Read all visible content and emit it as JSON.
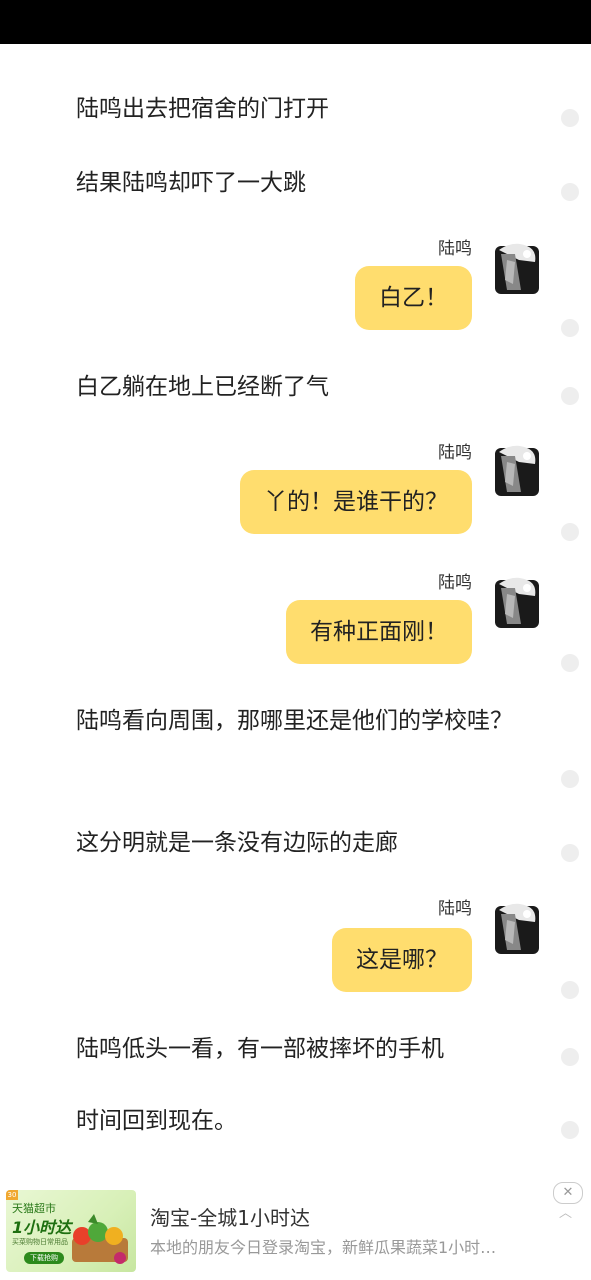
{
  "story": {
    "p1": "陆鸣出去把宿舍的门打开",
    "p2": "结果陆鸣却吓了一大跳",
    "p3": "白乙躺在地上已经断了气",
    "p4": "陆鸣看向周围，那哪里还是他们的学校哇？",
    "p5": "这分明就是一条没有边际的走廊",
    "p6": "陆鸣低头一看，有一部被摔坏的手机",
    "p7": "时间回到现在。"
  },
  "dialogs": [
    {
      "speaker": "陆鸣",
      "text": "白乙！"
    },
    {
      "speaker": "陆鸣",
      "text": "丫的！是谁干的？"
    },
    {
      "speaker": "陆鸣",
      "text": "有种正面刚！"
    },
    {
      "speaker": "陆鸣",
      "text": "这是哪？"
    }
  ],
  "ad": {
    "title": "淘宝-全城1小时达",
    "description": "本地的朋友今日登录淘宝，新鲜瓜果蔬菜1小时…",
    "thumb_line1": "天猫超市",
    "thumb_line2": "1小时达",
    "thumb_line3": "买菜购物日常用品",
    "thumb_button": "下载抢购",
    "close_icon": "✕",
    "collapse_icon": "︿"
  },
  "colors": {
    "bubble": "#ffdd6e",
    "background": "#ffffff",
    "status_bar": "#000000"
  }
}
